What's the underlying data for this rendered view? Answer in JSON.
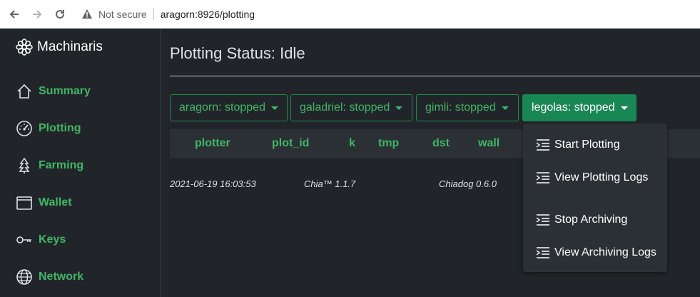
{
  "browser": {
    "security": "Not secure",
    "url": "aragorn:8926/plotting"
  },
  "sidebar": {
    "brand": "Machinaris",
    "items": [
      {
        "label": "Summary",
        "icon": "house-icon"
      },
      {
        "label": "Plotting",
        "icon": "speedometer-icon"
      },
      {
        "label": "Farming",
        "icon": "tree-icon"
      },
      {
        "label": "Wallet",
        "icon": "wallet-icon"
      },
      {
        "label": "Keys",
        "icon": "key-icon"
      },
      {
        "label": "Network",
        "icon": "globe-icon"
      }
    ]
  },
  "main": {
    "title": "Plotting Status: Idle",
    "workers": [
      {
        "label": "aragorn: stopped"
      },
      {
        "label": "galadriel: stopped"
      },
      {
        "label": "gimli: stopped"
      },
      {
        "label": "legolas: stopped",
        "active": true
      }
    ],
    "table": {
      "columns": [
        "plotter",
        "plot_id",
        "k",
        "tmp",
        "dst",
        "wall"
      ],
      "row": [
        "2021-06-19 16:03:53",
        "Chia™ 1.1.7",
        "Chiadog 0.6.0"
      ]
    },
    "dropdown": {
      "items": [
        {
          "label": "Start Plotting"
        },
        {
          "label": "View Plotting Logs"
        },
        {
          "label": "Stop Archiving"
        },
        {
          "label": "View Archiving Logs"
        }
      ]
    }
  },
  "colors": {
    "accent": "#3fb667",
    "active_button": "#198754",
    "background": "#212529"
  }
}
